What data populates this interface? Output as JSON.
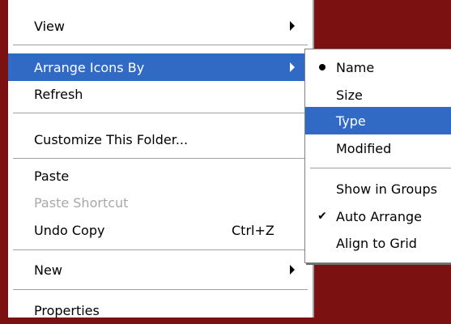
{
  "main_menu": {
    "items": [
      {
        "label": "View"
      },
      {
        "label": "Arrange Icons By"
      },
      {
        "label": "Refresh"
      },
      {
        "label": "Customize This Folder..."
      },
      {
        "label": "Paste"
      },
      {
        "label": "Paste Shortcut"
      },
      {
        "label": "Undo Copy",
        "shortcut": "Ctrl+Z"
      },
      {
        "label": "New"
      },
      {
        "label": "Properties"
      }
    ]
  },
  "sub_menu": {
    "items": [
      {
        "label": "Name",
        "marker": "bullet"
      },
      {
        "label": "Size"
      },
      {
        "label": "Type"
      },
      {
        "label": "Modified"
      },
      {
        "label": "Show in Groups"
      },
      {
        "label": "Auto Arrange",
        "check": "✔"
      },
      {
        "label": "Align to Grid"
      }
    ]
  },
  "colors": {
    "highlight": "#316ac5",
    "frame": "#7b1111",
    "disabled": "#a8a8a8"
  }
}
